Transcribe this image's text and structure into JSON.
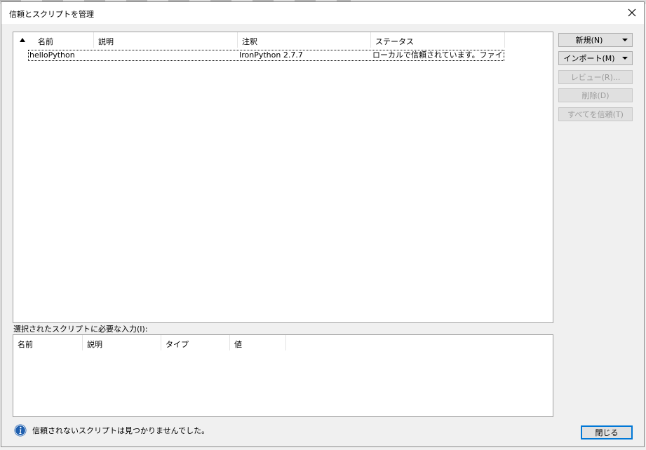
{
  "window": {
    "title": "信頼とスクリプトを管理"
  },
  "scripts_table": {
    "columns": [
      "名前",
      "説明",
      "注釈",
      "ステータス"
    ],
    "rows": [
      {
        "name": "helloPython",
        "description": "",
        "annotation": "IronPython 2.7.7",
        "status": "ローカルで信頼されています。ファイル..."
      }
    ]
  },
  "buttons": {
    "new": "新規(N)",
    "import": "インポート(M)",
    "review": "レビュー(R)...",
    "delete": "削除(D)",
    "trust_all": "すべてを信頼(T)",
    "close": "閉じる"
  },
  "inputs_section": {
    "label": "選択されたスクリプトに必要な入力(I):",
    "columns": [
      "名前",
      "説明",
      "タイプ",
      "値"
    ]
  },
  "status": {
    "message": "信頼されないスクリプトは見つかりませんでした。"
  },
  "colors": {
    "info_icon": "#1f5fae",
    "focus_border": "#0078d7"
  }
}
